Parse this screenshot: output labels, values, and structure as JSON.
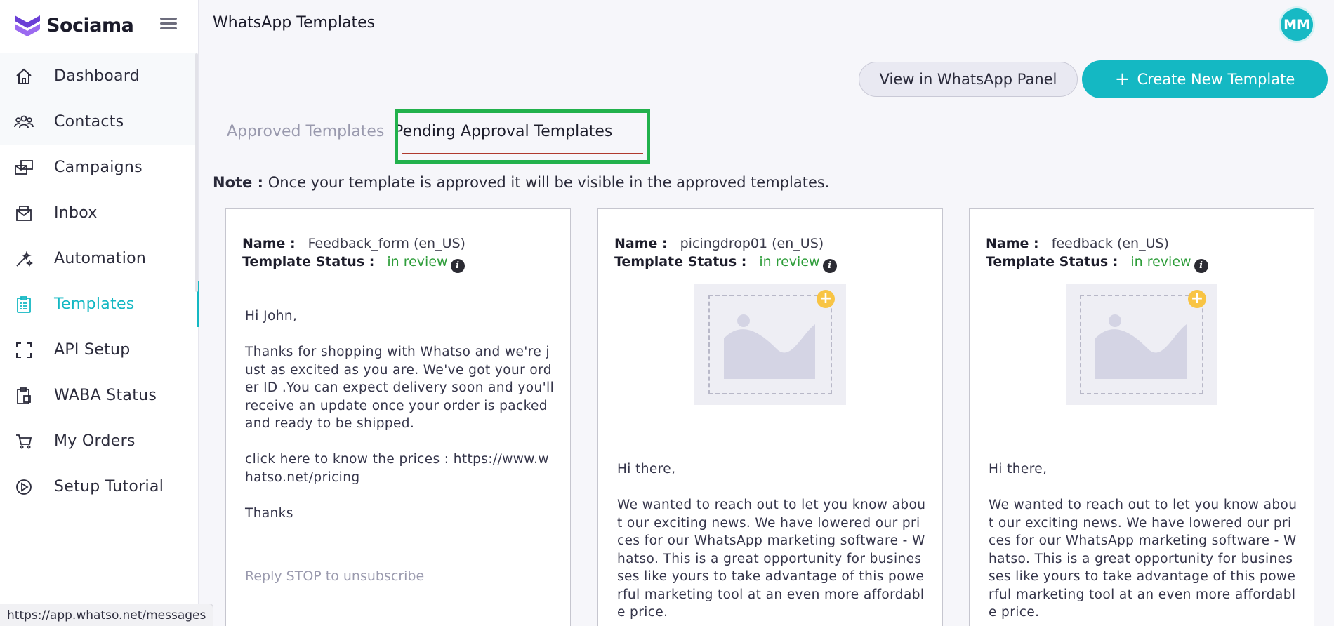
{
  "brand": {
    "name": "Sociama"
  },
  "header": {
    "title": "WhatsApp Templates",
    "avatar_initials": "MM"
  },
  "sidebar": {
    "items": [
      {
        "label": "Dashboard",
        "icon": "home-icon",
        "active": false
      },
      {
        "label": "Contacts",
        "icon": "contacts-icon",
        "active": false
      },
      {
        "label": "Campaigns",
        "icon": "campaigns-icon",
        "active": false
      },
      {
        "label": "Inbox",
        "icon": "inbox-icon",
        "active": false
      },
      {
        "label": "Automation",
        "icon": "automation-icon",
        "active": false
      },
      {
        "label": "Templates",
        "icon": "templates-icon",
        "active": true
      },
      {
        "label": "API Setup",
        "icon": "api-icon",
        "active": false
      },
      {
        "label": "WABA Status",
        "icon": "waba-icon",
        "active": false
      },
      {
        "label": "My Orders",
        "icon": "cart-icon",
        "active": false
      },
      {
        "label": "Setup Tutorial",
        "icon": "play-icon",
        "active": false
      }
    ]
  },
  "actions": {
    "view_label": "View in WhatsApp Panel",
    "create_label": "Create New Template",
    "create_icon": "+"
  },
  "tabs": [
    {
      "label": "Approved Templates",
      "active": false
    },
    {
      "label": "Pending Approval Templates",
      "active": true
    }
  ],
  "note": {
    "label": "Note :",
    "text": "Once your template is approved it will be visible in the approved templates."
  },
  "cards": [
    {
      "name_label": "Name :",
      "name": "Feedback_form (en_US)",
      "status_label": "Template Status :",
      "status": "in review",
      "body": "Hi John,\n\nThanks for shopping with Whatso and we're just as excited as you are. We've got your order ID .You can expect delivery soon and you'll receive an update once your order is packed and ready to be shipped.\n\nclick here to know the prices : https://www.whatso.net/pricing\n\nThanks",
      "footer": "Reply STOP to unsubscribe"
    },
    {
      "name_label": "Name :",
      "name": "picingdrop01 (en_US)",
      "status_label": "Template Status :",
      "status": "in review",
      "body": "Hi there,\n\nWe wanted to reach out to let you know about our exciting news. We have lowered our prices for our WhatsApp marketing software - Whatso. This is a great opportunity for businesses like yours to take advantage of this powerful marketing tool at an even more affordable price."
    },
    {
      "name_label": "Name :",
      "name": "feedback (en_US)",
      "status_label": "Template Status :",
      "status": "in review",
      "body": "Hi there,\n\nWe wanted to reach out to let you know about our exciting news. We have lowered our prices for our WhatsApp marketing software - Whatso. This is a great opportunity for businesses like yours to take advantage of this powerful marketing tool at an even more affordable price."
    }
  ],
  "statusbar": {
    "url": "https://app.whatso.net/messages"
  },
  "colors": {
    "accent": "#14b8c3",
    "status_green": "#2e9d3a",
    "highlight_box": "#22b14c"
  }
}
